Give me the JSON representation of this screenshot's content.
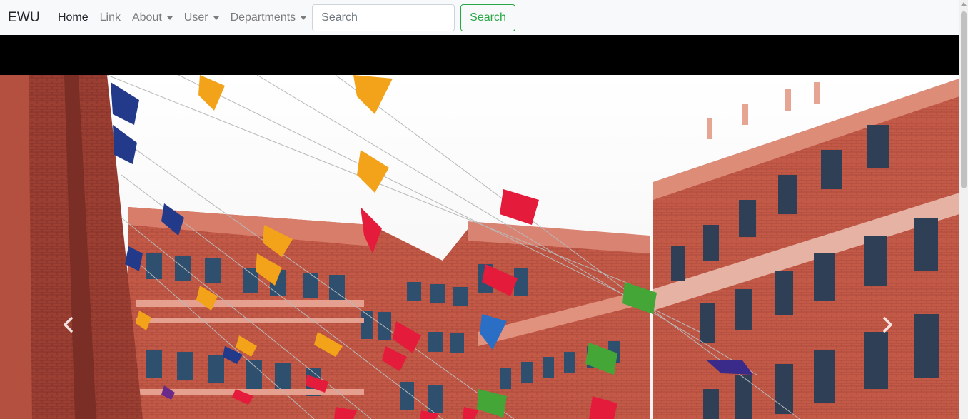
{
  "navbar": {
    "brand": "EWU",
    "items": [
      {
        "label": "Home"
      },
      {
        "label": "Link"
      },
      {
        "label": "About"
      },
      {
        "label": "User"
      },
      {
        "label": "Departments"
      }
    ],
    "search": {
      "placeholder": "Search",
      "button_label": "Search"
    }
  },
  "carousel": {
    "image": "campus-building-photo",
    "controls": {
      "prev_icon": "chevron-left-icon",
      "next_icon": "chevron-right-icon"
    }
  },
  "colors": {
    "navbar_bg": "#f8f9fa",
    "success": "#28a745",
    "brick": "#c8594a"
  }
}
